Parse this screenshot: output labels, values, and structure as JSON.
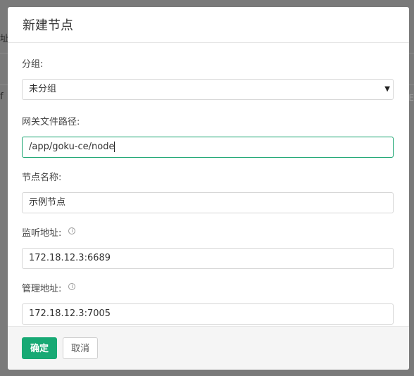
{
  "background": {
    "fragment_top": "址",
    "fragment_mid": "f",
    "fragment_right": "E"
  },
  "modal": {
    "title": "新建节点",
    "fields": {
      "group": {
        "label": "分组:",
        "value": "未分组"
      },
      "gateway_path": {
        "label": "网关文件路径:",
        "value": "/app/goku-ce/node"
      },
      "node_name": {
        "label": "节点名称:",
        "value": "示例节点"
      },
      "listen_address": {
        "label": "监听地址:",
        "value": "172.18.12.3:6689"
      },
      "admin_address": {
        "label": "管理地址:",
        "value": "172.18.12.3:7005"
      }
    },
    "footer": {
      "confirm_label": "确定",
      "cancel_label": "取消"
    }
  },
  "colors": {
    "accent": "#17a974",
    "focus_border": "#15a36e"
  },
  "icons": {
    "info": "info-circle-icon",
    "dropdown": "caret-down-icon"
  }
}
